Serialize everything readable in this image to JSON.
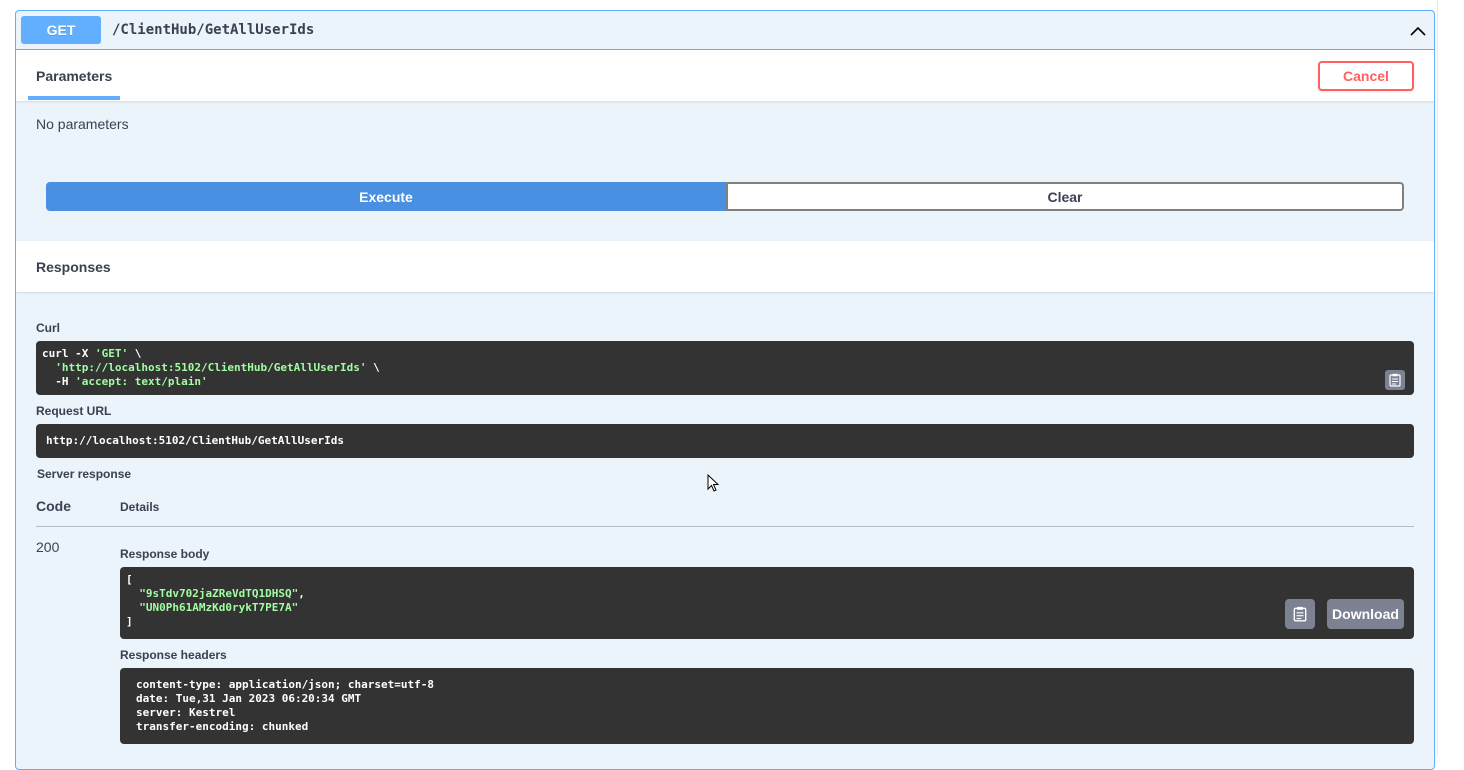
{
  "operation": {
    "method": "GET",
    "path": "/ClientHub/GetAllUserIds"
  },
  "parameters": {
    "tab_label": "Parameters",
    "cancel_label": "Cancel",
    "empty_text": "No parameters"
  },
  "actions": {
    "execute_label": "Execute",
    "clear_label": "Clear"
  },
  "responses": {
    "title": "Responses",
    "curl_label": "Curl",
    "curl_line1_cmd": "curl -X ",
    "curl_line1_method": "'GET'",
    "curl_line1_end": " \\",
    "curl_line2_url": "'http://localhost:5102/ClientHub/GetAllUserIds'",
    "curl_line2_end": " \\",
    "curl_line3_flag": "  -H ",
    "curl_line3_header": "'accept: text/plain'",
    "request_url_label": "Request URL",
    "request_url": "http://localhost:5102/ClientHub/GetAllUserIds",
    "server_response_label": "Server response",
    "code_col": "Code",
    "details_col": "Details",
    "status_code": "200",
    "response_body_label": "Response body",
    "body_open": "[",
    "body_item1": "\"9sTdv702jaZReVdTQ1DHSQ\"",
    "body_comma": ",",
    "body_item2": "\"UN0Ph61AMzKd0rykT7PE7A\"",
    "body_close": "]",
    "download_label": "Download",
    "response_headers_label": "Response headers",
    "headers": [
      "content-type: application/json; charset=utf-8",
      "date: Tue,31 Jan 2023 06:20:34 GMT",
      "server: Kestrel",
      "transfer-encoding: chunked"
    ]
  },
  "colors": {
    "method_get": "#61affe",
    "execute": "#4990e2",
    "cancel": "#ff6060",
    "code_bg": "#333333",
    "string": "#a2fca2"
  }
}
